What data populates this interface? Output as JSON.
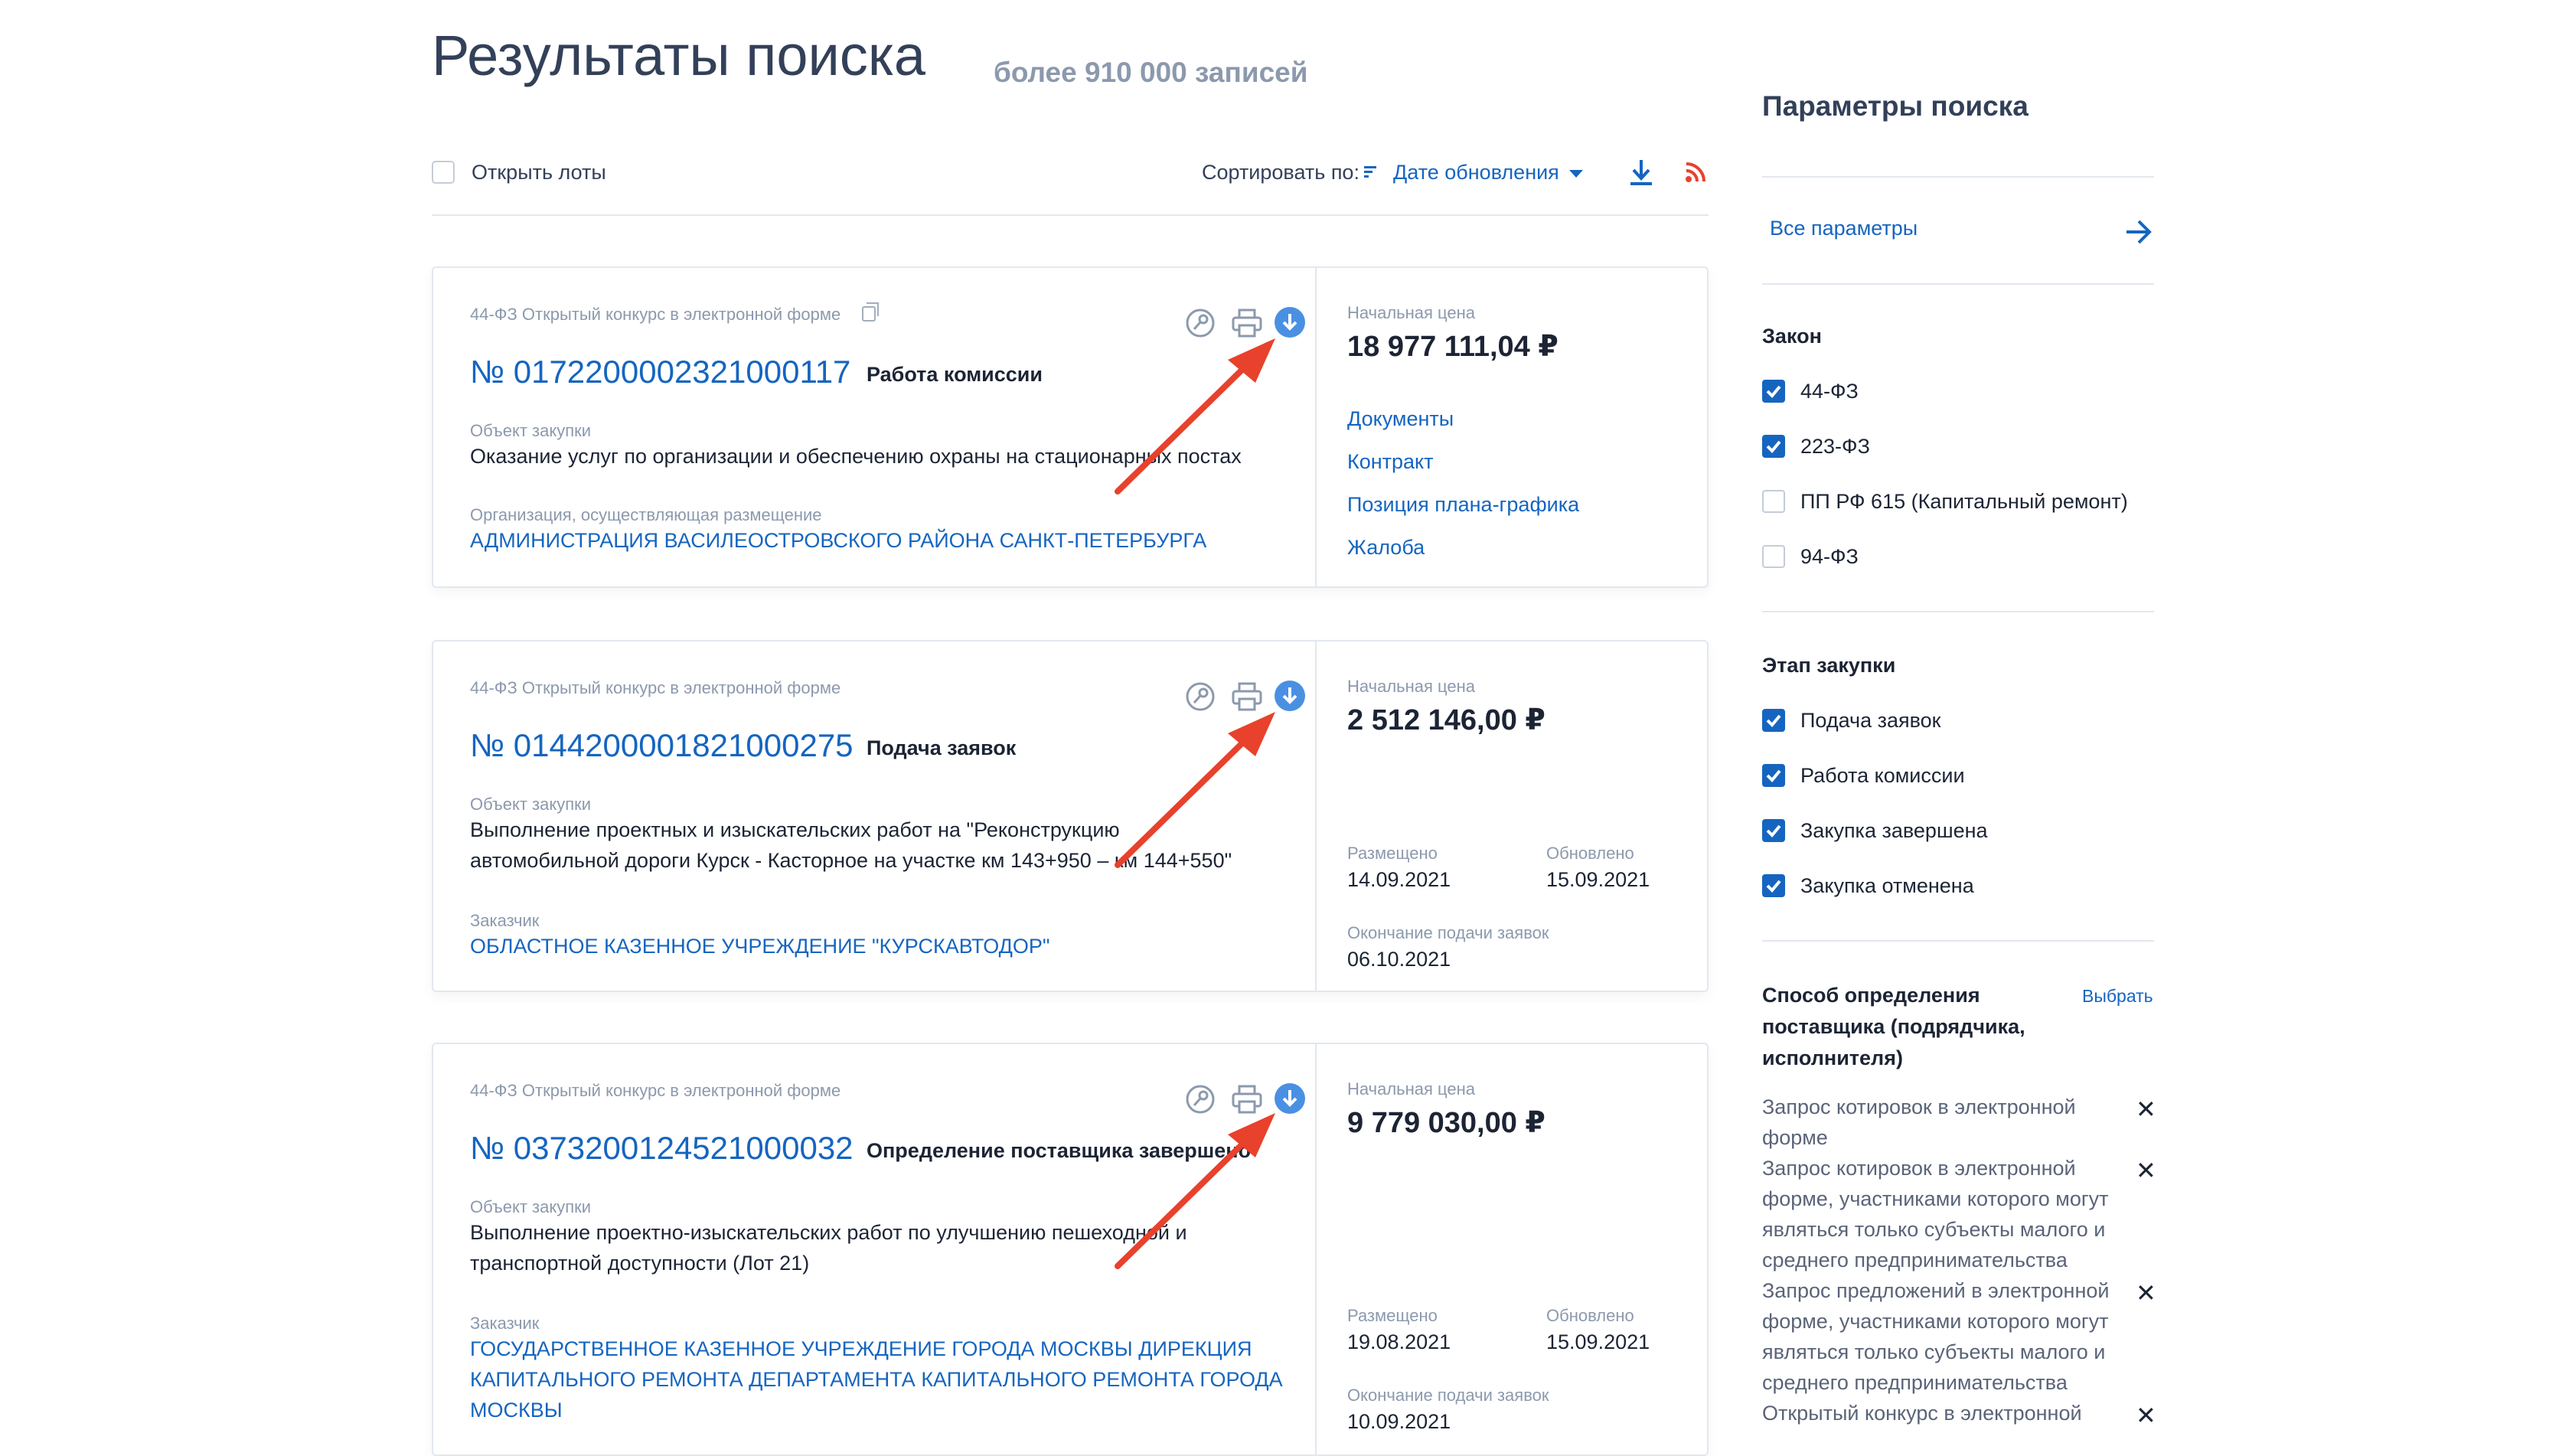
{
  "header": {
    "title": "Результаты поиска",
    "count": "более 910 000 записей"
  },
  "toolbar": {
    "open_lots_label": "Открыть лоты",
    "sort_label": "Сортировать по:",
    "sort_value": "Дате обновления",
    "icons": [
      "sort-icon",
      "download-icon",
      "rss-icon"
    ]
  },
  "results": [
    {
      "type": "44-ФЗ Открытый конкурс в электронной форме",
      "number": "№ 0172200002321000117",
      "status": "Работа комиссии",
      "object_label": "Объект закупки",
      "object_lines": [
        "Оказание услуг по организации и обеспечению охраны на стационарных постах"
      ],
      "org_label": "Организация, осуществляющая размещение",
      "org_lines": [
        "АДМИНИСТРАЦИЯ ВАСИЛЕОСТРОВСКОГО РАЙОНА САНКТ-ПЕТЕРБУРГА"
      ],
      "price_label": "Начальная цена",
      "price": "18 977 111,04 ₽",
      "links": [
        "Документы",
        "Контракт",
        "Позиция плана-графика",
        "Жалоба"
      ]
    },
    {
      "type": "44-ФЗ Открытый конкурс в электронной форме",
      "number": "№ 0144200001821000275",
      "status": "Подача заявок",
      "object_label": "Объект закупки",
      "object_lines": [
        "Выполнение проектных и изыскательских работ на \"Реконструкцию",
        "автомобильной дороги Курск - Касторное на участке км 143+950 – км 144+550\""
      ],
      "org_label": "Заказчик",
      "org_lines": [
        "ОБЛАСТНОЕ КАЗЕННОЕ УЧРЕЖДЕНИЕ \"КУРСКАВТОДОР\""
      ],
      "price_label": "Начальная цена",
      "price": "2 512 146,00 ₽",
      "posted_label": "Размещено",
      "posted": "14.09.2021",
      "updated_label": "Обновлено",
      "updated": "15.09.2021",
      "deadline_label": "Окончание подачи заявок",
      "deadline": "06.10.2021"
    },
    {
      "type": "44-ФЗ Открытый конкурс в электронной форме",
      "number": "№ 0373200124521000032",
      "status": "Определение поставщика завершено",
      "object_label": "Объект закупки",
      "object_lines": [
        "Выполнение проектно-изыскательских работ по улучшению пешеходной и",
        "транспортной доступности (Лот 21)"
      ],
      "org_label": "Заказчик",
      "org_lines": [
        "ГОСУДАРСТВЕННОЕ КАЗЕННОЕ УЧРЕЖДЕНИЕ ГОРОДА МОСКВЫ ДИРЕКЦИЯ",
        "КАПИТАЛЬНОГО РЕМОНТА ДЕПАРТАМЕНТА КАПИТАЛЬНОГО РЕМОНТА ГОРОДА",
        "МОСКВЫ"
      ],
      "price_label": "Начальная цена",
      "price": "9 779 030,00 ₽",
      "posted_label": "Размещено",
      "posted": "19.08.2021",
      "updated_label": "Обновлено",
      "updated": "15.09.2021",
      "deadline_label": "Окончание подачи заявок",
      "deadline": "10.09.2021"
    }
  ],
  "filters": {
    "title": "Параметры поиска",
    "all_params": "Все параметры",
    "law": {
      "title": "Закон",
      "options": [
        {
          "label": "44-ФЗ",
          "checked": true
        },
        {
          "label": "223-ФЗ",
          "checked": true
        },
        {
          "label": "ПП РФ 615 (Капитальный ремонт)",
          "checked": false
        },
        {
          "label": "94-ФЗ",
          "checked": false
        }
      ]
    },
    "stage": {
      "title": "Этап закупки",
      "options": [
        {
          "label": "Подача заявок",
          "checked": true
        },
        {
          "label": "Работа комиссии",
          "checked": true
        },
        {
          "label": "Закупка завершена",
          "checked": true
        },
        {
          "label": "Закупка отменена",
          "checked": true
        }
      ]
    },
    "method": {
      "title_lines": [
        "Способ определения",
        "поставщика (подрядчика,",
        "исполнителя)"
      ],
      "select": "Выбрать",
      "items": [
        [
          "Запрос котировок в электронной",
          "форме"
        ],
        [
          "Запрос котировок в электронной",
          "форме, участниками которого могут",
          "являться только субъекты малого и",
          "среднего предпринимательства"
        ],
        [
          "Запрос предложений в электронной",
          "форме, участниками которого могут",
          "являться только субъекты малого и",
          "среднего предпринимательства"
        ],
        [
          "Открытый конкурс в электронной"
        ]
      ],
      "remove_symbol": "✕"
    }
  },
  "colors": {
    "accent": "#1565c0",
    "annotation": "#e8412c",
    "muted": "#8c99ad"
  }
}
